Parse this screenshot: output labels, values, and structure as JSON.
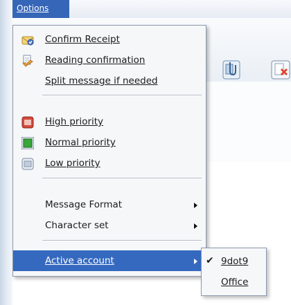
{
  "menubar": {
    "options_label": "Options"
  },
  "menu": {
    "items": [
      {
        "label": "Confirm Receipt",
        "icon": "confirm-receipt-icon"
      },
      {
        "label": "Reading confirmation",
        "icon": "reading-confirmation-icon"
      },
      {
        "label": "Split message if needed",
        "icon": ""
      },
      {
        "label": "High priority",
        "icon": "high-priority-icon"
      },
      {
        "label": "Normal priority",
        "icon": "normal-priority-icon"
      },
      {
        "label": "Low priority",
        "icon": "low-priority-icon"
      },
      {
        "label": "Message Format",
        "icon": "",
        "submenu": true
      },
      {
        "label": "Character set",
        "icon": "",
        "submenu": true
      },
      {
        "label": "Active account",
        "icon": "",
        "submenu": true,
        "highlighted": true
      }
    ]
  },
  "submenu": {
    "items": [
      {
        "label": "9dot9",
        "checked": true
      },
      {
        "label": "Office",
        "checked": false
      }
    ]
  },
  "colors": {
    "highlight": "#3569c0",
    "menubar_highlight": "#3666b8",
    "high_priority": "#d24a3a",
    "normal_priority": "#3aa63a",
    "low_priority": "#7a8aa3"
  }
}
